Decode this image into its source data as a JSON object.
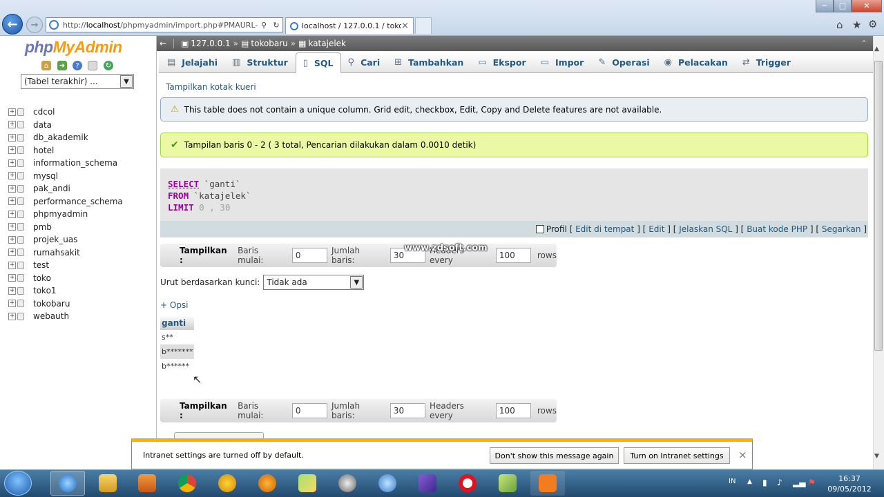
{
  "browser": {
    "address": "http://localhost/phpmyadmin/import.php#PMAURL-...",
    "address_display_prefix": "http://",
    "address_host": "localhost",
    "address_path": "/phpmyadmin/import.php#PMAURL-",
    "tab_title": "localhost / 127.0.0.1 / tokob...",
    "tab_close": "×"
  },
  "sidebar": {
    "logo_php": "php",
    "logo_myadmin": "MyAdmin",
    "recent_select": "(Tabel terakhir) ...",
    "databases": [
      "cdcol",
      "data",
      "db_akademik",
      "hotel",
      "information_schema",
      "mysql",
      "pak_andi",
      "performance_schema",
      "phpmyadmin",
      "pmb",
      "projek_uas",
      "rumahsakit",
      "test",
      "toko",
      "toko1",
      "tokobaru",
      "webauth"
    ]
  },
  "breadcrumb": {
    "server": "127.0.0.1",
    "database": "tokobaru",
    "table": "katajelek",
    "separator": "»"
  },
  "tabs": [
    {
      "label": "Jelajahi",
      "icon": "browse-icon"
    },
    {
      "label": "Struktur",
      "icon": "structure-icon"
    },
    {
      "label": "SQL",
      "icon": "sql-icon",
      "active": true
    },
    {
      "label": "Cari",
      "icon": "search-icon"
    },
    {
      "label": "Tambahkan",
      "icon": "insert-icon"
    },
    {
      "label": "Ekspor",
      "icon": "export-icon"
    },
    {
      "label": "Impor",
      "icon": "import-icon"
    },
    {
      "label": "Operasi",
      "icon": "operations-icon"
    },
    {
      "label": "Pelacakan",
      "icon": "tracking-icon"
    },
    {
      "label": "Trigger",
      "icon": "trigger-icon"
    }
  ],
  "main": {
    "show_query_box": "Tampilkan kotak kueri",
    "notice": "This table does not contain a unique column. Grid edit, checkbox, Edit, Copy and Delete features are not available.",
    "success": "Tampilan baris 0 - 2 ( 3 total, Pencarian dilakukan dalam 0.0010 detik)",
    "sql": {
      "select_kw": "SELECT",
      "select_col": "`ganti`",
      "from_kw": "FROM",
      "from_tbl": "`katajelek`",
      "limit_kw": "LIMIT",
      "limit_a": "0",
      "limit_comma": ",",
      "limit_b": "30"
    },
    "sql_links": {
      "profil": "Profil",
      "edit_inline": "Edit di tempat",
      "edit": "Edit",
      "explain": "Jelaskan SQL",
      "php": "Buat kode PHP",
      "refresh": "Segarkan"
    },
    "nav": {
      "show_label": "Tampilkan :",
      "start_label": "Baris mulai:",
      "start_value": "0",
      "count_label": "Jumlah baris:",
      "count_value": "30",
      "headers_label": "Headers every",
      "headers_value": "100",
      "rows_label": "rows"
    },
    "sort_label": "Urut berdasarkan kunci:",
    "sort_value": "Tidak ada",
    "options_link": "+ Opsi",
    "result_header": "ganti",
    "results": [
      "s**",
      "b*******",
      "b******"
    ]
  },
  "watermark": "www.zdsoft.com",
  "infobar": {
    "message": "Intranet settings are turned off by default.",
    "btn_dont_show": "Don't show this message again",
    "btn_turn_on": "Turn on Intranet settings",
    "close": "×"
  },
  "taskbar": {
    "lang": "IN",
    "time": "16:37",
    "date": "09/05/2012"
  },
  "colors": {
    "link": "#235a81",
    "keyword": "#990099",
    "success_bg": "#ebf8a4",
    "notice_bg": "#e8eef1"
  }
}
